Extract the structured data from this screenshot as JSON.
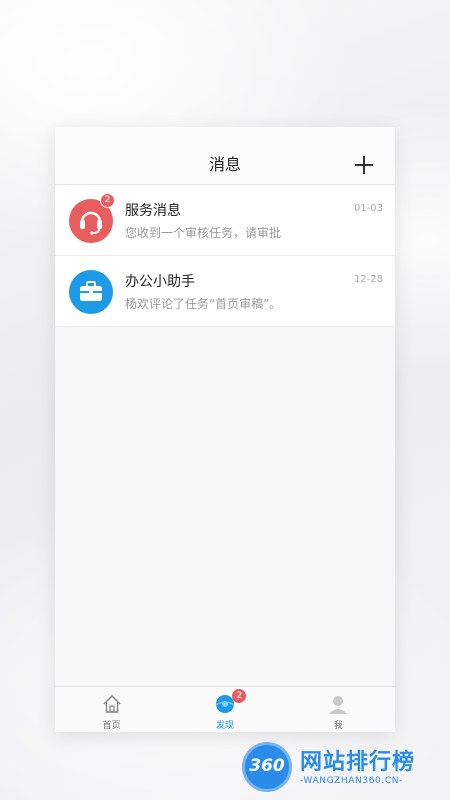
{
  "nav": {
    "title": "消息",
    "add_icon": "plus-icon"
  },
  "messages": [
    {
      "title": "服务消息",
      "subtitle": "您收到一个审核任务，请审批",
      "time": "01-03",
      "badge": "2",
      "icon": "headset-icon",
      "color": "#e85d5d"
    },
    {
      "title": "办公小助手",
      "subtitle": "杨欢评论了任务“首页审稿”。",
      "time": "12-28",
      "icon": "briefcase-icon",
      "color": "#1e9be6"
    }
  ],
  "tabbar": {
    "tabs": [
      {
        "label": "首页",
        "icon": "home-icon"
      },
      {
        "label": "发现",
        "icon": "discover-icon",
        "badge": "2",
        "active": true
      },
      {
        "label": "我",
        "icon": "profile-icon"
      }
    ]
  },
  "watermark": {
    "logo_text": "360",
    "brand": "网站排行榜",
    "domain": "-WANGZHAN360.CN-"
  },
  "colors": {
    "accent_blue": "#1e9be6",
    "badge_red": "#e85d5d"
  }
}
